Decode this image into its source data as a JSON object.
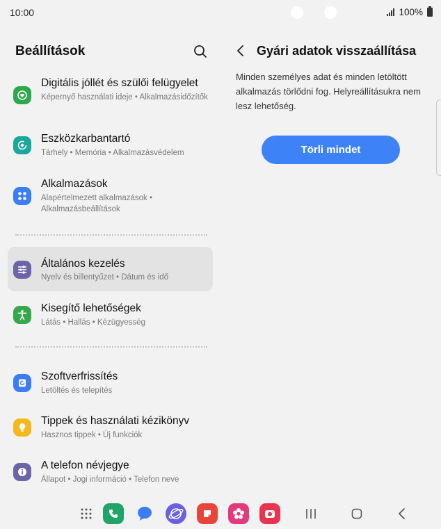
{
  "status_bar": {
    "time": "10:00",
    "battery": "100%"
  },
  "left_pane": {
    "title": "Beállítások",
    "items": [
      {
        "title": "Digitális jóllét és szülői felügyelet",
        "subtitle": "Képernyő használati ideje • Alkalmazásidőzítők",
        "icon": "heart-ring-icon",
        "color": "#2ea84c"
      },
      {
        "title": "Eszközkarbantartó",
        "subtitle": "Tárhely • Memória • Alkalmazásvédelem",
        "icon": "refresh-ring-icon",
        "color": "#1ba79d"
      },
      {
        "title": "Alkalmazások",
        "subtitle": "Alapértelmezett alkalmazások • Alkalmazásbeállítások",
        "icon": "apps-grid-icon",
        "color": "#3b7df5"
      },
      {
        "title": "Általános kezelés",
        "subtitle": "Nyelv és billentyűzet • Dátum és idő",
        "icon": "sliders-icon",
        "color": "#6a64a8"
      },
      {
        "title": "Kisegítő lehetőségek",
        "subtitle": "Látás • Hallás • Kézügyesség",
        "icon": "accessibility-icon",
        "color": "#35a84a"
      },
      {
        "title": "Szoftverfrissítés",
        "subtitle": "Letöltés és telepítés",
        "icon": "update-icon",
        "color": "#3b7df5"
      },
      {
        "title": "Tippek és használati kézikönyv",
        "subtitle": "Hasznos tippek • Új funkciók",
        "icon": "lightbulb-icon",
        "color": "#f5b81c"
      },
      {
        "title": "A telefon névjegye",
        "subtitle": "Állapot • Jogi információ • Telefon neve",
        "icon": "info-icon",
        "color": "#6a64a8"
      }
    ]
  },
  "right_pane": {
    "title": "Gyári adatok visszaállítása",
    "description": "Minden személyes adat és minden letöltött alkalmazás törlődni fog. Helyreállításukra nem lesz lehetőség.",
    "button_label": "Törli mindet",
    "accent": "#3e82f7"
  },
  "dock": {
    "apps": [
      {
        "name": "app-drawer-icon"
      },
      {
        "name": "phone-app-icon",
        "color": "#1ea567"
      },
      {
        "name": "messages-app-icon",
        "color": "#3b7df5"
      },
      {
        "name": "internet-app-icon",
        "color": "#6a5fe0"
      },
      {
        "name": "notes-app-icon",
        "color": "#e8443a"
      },
      {
        "name": "gallery-app-icon",
        "color": "#e33a7e"
      },
      {
        "name": "camera-app-icon",
        "color": "#e8344e"
      }
    ]
  }
}
